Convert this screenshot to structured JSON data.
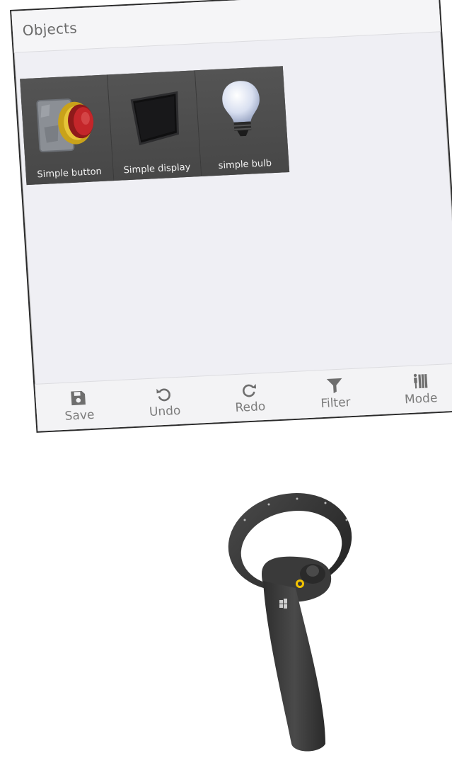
{
  "panel": {
    "title": "Objects"
  },
  "objects": [
    {
      "label": "Simple button",
      "icon": "red-push-button-icon"
    },
    {
      "label": "Simple display",
      "icon": "display-screen-icon"
    },
    {
      "label": "simple bulb",
      "icon": "light-bulb-icon"
    }
  ],
  "toolbar": {
    "save_label": "Save",
    "undo_label": "Undo",
    "redo_label": "Redo",
    "filter_label": "Filter",
    "mode_label": "Mode"
  },
  "colors": {
    "panel_bg": "#efeff4",
    "tile_bg": "#4a4a4a",
    "toolbar_text": "#7c7c7c",
    "controller_body": "#3a3a3a",
    "controller_accent": "#f2c300"
  }
}
